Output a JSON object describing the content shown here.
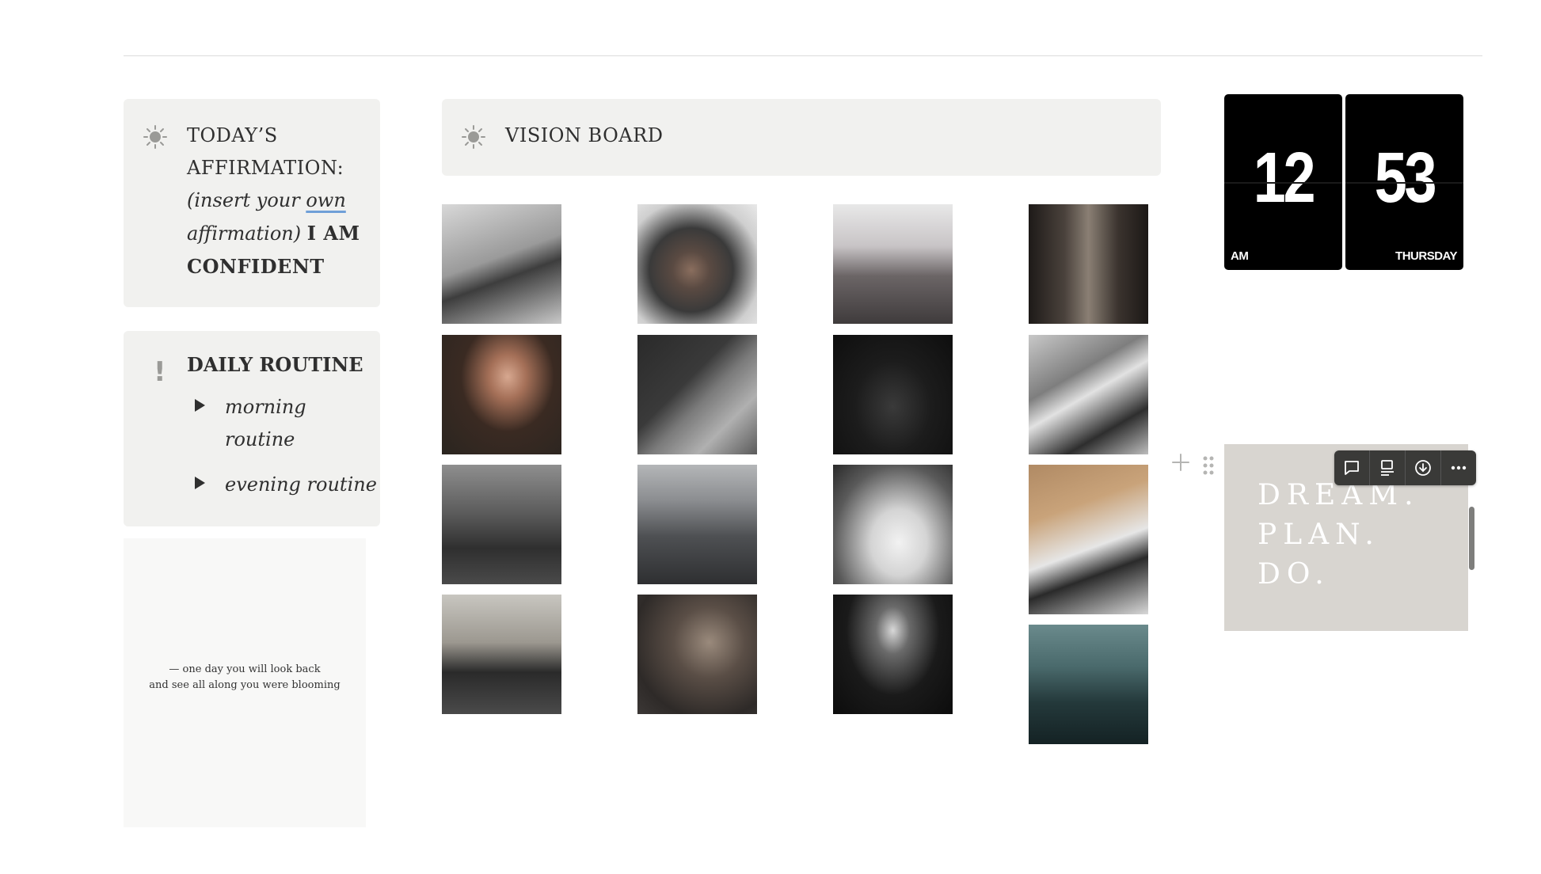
{
  "affirmation": {
    "icon": "sun-icon",
    "title_line1": "TODAY’S",
    "title_line2": "AFFIRMATION:",
    "insert_pre": "(insert your ",
    "insert_own": "own",
    "insert_post": " affirmation)",
    "statement": "I AM CONFIDENT"
  },
  "routine": {
    "icon": "exclamation-icon",
    "icon_glyph": "!",
    "title": "DAILY ROUTINE",
    "toggles": [
      "morning routine",
      "evening routine"
    ]
  },
  "quote": {
    "line1": "— one day you will look back",
    "line2": "and see all along you were blooming"
  },
  "vision_board": {
    "icon": "sun-icon",
    "title": "VISION BOARD",
    "images": [
      "woman-writing-at-desk",
      "woman-on-bed",
      "pagoda-cherry-blossoms",
      "dark-interior-room",
      "woman-holding-book",
      "sequined-dress-detail",
      "leather-jacket-boots",
      "vogue-magazines",
      "couple-at-beach",
      "city-skyline",
      "bride-in-gown",
      "boxes-and-bags",
      "car-on-street",
      "mirror-selfie-with-drink",
      "eiffel-tower-night",
      "misty-forest-road"
    ]
  },
  "clock": {
    "hour": "12",
    "minute": "53",
    "ampm": "AM",
    "day": "THURSDAY"
  },
  "dream": {
    "line1": "DREAM.",
    "line2": "PLAN.",
    "line3": "DO."
  },
  "toolbar": {
    "buttons": [
      "comment-icon",
      "caption-icon",
      "download-icon",
      "more-icon"
    ]
  },
  "colors": {
    "callout_bg": "#f1f1ef",
    "dream_bg": "#d8d5d0",
    "clock_bg": "#000000",
    "toolbar_bg": "#3a3a38",
    "underline_accent": "#6f9fd8"
  }
}
